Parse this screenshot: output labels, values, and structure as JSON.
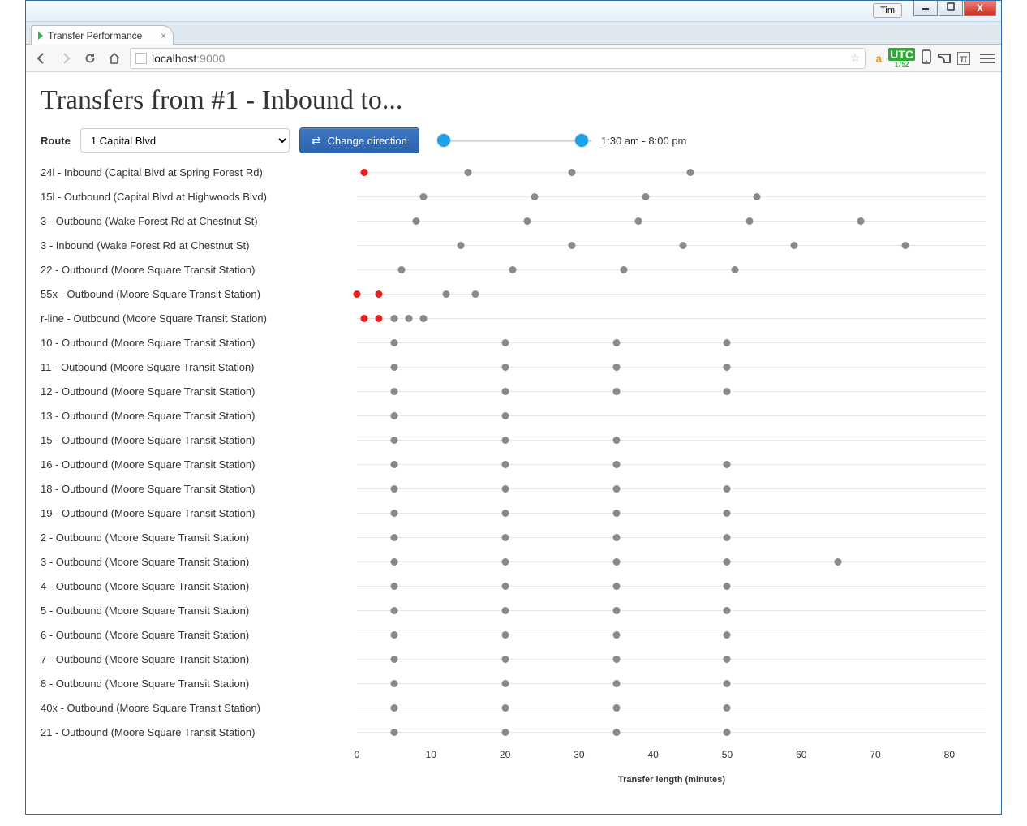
{
  "window": {
    "user_label": "Tim",
    "min": "—",
    "max": "▢",
    "close": "X"
  },
  "tab": {
    "title": "Transfer Performance",
    "close": "×"
  },
  "omnibox": {
    "host": "localhost",
    "rest": ":9000"
  },
  "ext": {
    "utc_top": "UTC",
    "utc_bottom": "1752"
  },
  "page": {
    "title": "Transfers from #1 - Inbound to...",
    "route_label": "Route",
    "route_selected": "1 Capital Blvd",
    "change_direction": "Change direction",
    "time_range_label": "1:30 am - 8:00 pm"
  },
  "chart_data": {
    "type": "scatter",
    "xlabel": "Transfer length (minutes)",
    "xlim": [
      0,
      85
    ],
    "ticks": [
      0,
      10,
      20,
      30,
      40,
      50,
      60,
      70,
      80
    ],
    "series": [
      {
        "name": "24l - Inbound (Capital Blvd at Spring Forest Rd)",
        "points": [
          {
            "x": 1,
            "red": true
          },
          {
            "x": 15
          },
          {
            "x": 29
          },
          {
            "x": 45
          }
        ]
      },
      {
        "name": "15l - Outbound (Capital Blvd at Highwoods Blvd)",
        "points": [
          {
            "x": 9
          },
          {
            "x": 24
          },
          {
            "x": 39
          },
          {
            "x": 54
          }
        ]
      },
      {
        "name": "3 - Outbound (Wake Forest Rd at Chestnut St)",
        "points": [
          {
            "x": 8
          },
          {
            "x": 23
          },
          {
            "x": 38
          },
          {
            "x": 53
          },
          {
            "x": 68
          }
        ]
      },
      {
        "name": "3 - Inbound (Wake Forest Rd at Chestnut St)",
        "points": [
          {
            "x": 14
          },
          {
            "x": 29
          },
          {
            "x": 44
          },
          {
            "x": 59
          },
          {
            "x": 74
          }
        ]
      },
      {
        "name": "22 - Outbound (Moore Square Transit Station)",
        "points": [
          {
            "x": 6
          },
          {
            "x": 21
          },
          {
            "x": 36
          },
          {
            "x": 51
          }
        ]
      },
      {
        "name": "55x - Outbound (Moore Square Transit Station)",
        "points": [
          {
            "x": 0,
            "red": true
          },
          {
            "x": 3,
            "red": true
          },
          {
            "x": 12
          },
          {
            "x": 16
          }
        ]
      },
      {
        "name": "r-line - Outbound (Moore Square Transit Station)",
        "points": [
          {
            "x": 1,
            "red": true
          },
          {
            "x": 3,
            "red": true
          },
          {
            "x": 5
          },
          {
            "x": 7
          },
          {
            "x": 9
          }
        ]
      },
      {
        "name": "10 - Outbound (Moore Square Transit Station)",
        "points": [
          {
            "x": 5
          },
          {
            "x": 20
          },
          {
            "x": 35
          },
          {
            "x": 50
          }
        ]
      },
      {
        "name": "11 - Outbound (Moore Square Transit Station)",
        "points": [
          {
            "x": 5
          },
          {
            "x": 20
          },
          {
            "x": 35
          },
          {
            "x": 50
          }
        ]
      },
      {
        "name": "12 - Outbound (Moore Square Transit Station)",
        "points": [
          {
            "x": 5
          },
          {
            "x": 20
          },
          {
            "x": 35
          },
          {
            "x": 50
          }
        ]
      },
      {
        "name": "13 - Outbound (Moore Square Transit Station)",
        "points": [
          {
            "x": 5
          },
          {
            "x": 20
          }
        ]
      },
      {
        "name": "15 - Outbound (Moore Square Transit Station)",
        "points": [
          {
            "x": 5
          },
          {
            "x": 20
          },
          {
            "x": 35
          }
        ]
      },
      {
        "name": "16 - Outbound (Moore Square Transit Station)",
        "points": [
          {
            "x": 5
          },
          {
            "x": 20
          },
          {
            "x": 35
          },
          {
            "x": 50
          }
        ]
      },
      {
        "name": "18 - Outbound (Moore Square Transit Station)",
        "points": [
          {
            "x": 5
          },
          {
            "x": 20
          },
          {
            "x": 35
          },
          {
            "x": 50
          }
        ]
      },
      {
        "name": "19 - Outbound (Moore Square Transit Station)",
        "points": [
          {
            "x": 5
          },
          {
            "x": 20
          },
          {
            "x": 35
          },
          {
            "x": 50
          }
        ]
      },
      {
        "name": "2 - Outbound (Moore Square Transit Station)",
        "points": [
          {
            "x": 5
          },
          {
            "x": 20
          },
          {
            "x": 35
          },
          {
            "x": 50
          }
        ]
      },
      {
        "name": "3 - Outbound (Moore Square Transit Station)",
        "points": [
          {
            "x": 5
          },
          {
            "x": 20
          },
          {
            "x": 35
          },
          {
            "x": 50
          },
          {
            "x": 65
          }
        ]
      },
      {
        "name": "4 - Outbound (Moore Square Transit Station)",
        "points": [
          {
            "x": 5
          },
          {
            "x": 20
          },
          {
            "x": 35
          },
          {
            "x": 50
          }
        ]
      },
      {
        "name": "5 - Outbound (Moore Square Transit Station)",
        "points": [
          {
            "x": 5
          },
          {
            "x": 20
          },
          {
            "x": 35
          },
          {
            "x": 50
          }
        ]
      },
      {
        "name": "6 - Outbound (Moore Square Transit Station)",
        "points": [
          {
            "x": 5
          },
          {
            "x": 20
          },
          {
            "x": 35
          },
          {
            "x": 50
          }
        ]
      },
      {
        "name": "7 - Outbound (Moore Square Transit Station)",
        "points": [
          {
            "x": 5
          },
          {
            "x": 20
          },
          {
            "x": 35
          },
          {
            "x": 50
          }
        ]
      },
      {
        "name": "8 - Outbound (Moore Square Transit Station)",
        "points": [
          {
            "x": 5
          },
          {
            "x": 20
          },
          {
            "x": 35
          },
          {
            "x": 50
          }
        ]
      },
      {
        "name": "40x - Outbound (Moore Square Transit Station)",
        "points": [
          {
            "x": 5
          },
          {
            "x": 20
          },
          {
            "x": 35
          },
          {
            "x": 50
          }
        ]
      },
      {
        "name": "21 - Outbound (Moore Square Transit Station)",
        "points": [
          {
            "x": 5
          },
          {
            "x": 20
          },
          {
            "x": 35
          },
          {
            "x": 50
          }
        ]
      }
    ]
  }
}
